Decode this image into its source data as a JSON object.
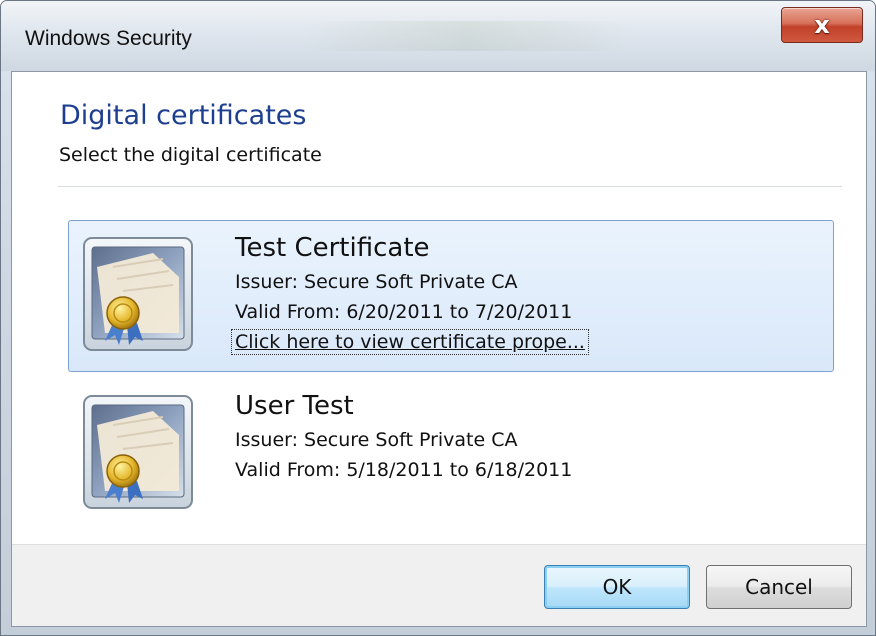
{
  "window": {
    "title": "Windows Security",
    "close_glyph": "x"
  },
  "header": {
    "title": "Digital certificates",
    "subtitle": "Select the digital certificate"
  },
  "certificates": [
    {
      "name": "Test Certificate",
      "issuer": "Issuer: Secure Soft Private CA",
      "valid": "Valid From: 6/20/2011 to 7/20/2011",
      "link": "Click here to view certificate prope...",
      "selected": true,
      "icon": "certificate-icon"
    },
    {
      "name": "User Test",
      "issuer": "Issuer: Secure Soft Private CA",
      "valid": "Valid From: 5/18/2011 to 6/18/2011",
      "selected": false,
      "icon": "certificate-icon"
    }
  ],
  "buttons": {
    "ok": "OK",
    "cancel": "Cancel"
  },
  "colors": {
    "header_title": "#1e3f8f",
    "selection_bg": "#d9e8fa",
    "selection_border": "#7da2ce",
    "close_button": "#c2412a"
  }
}
